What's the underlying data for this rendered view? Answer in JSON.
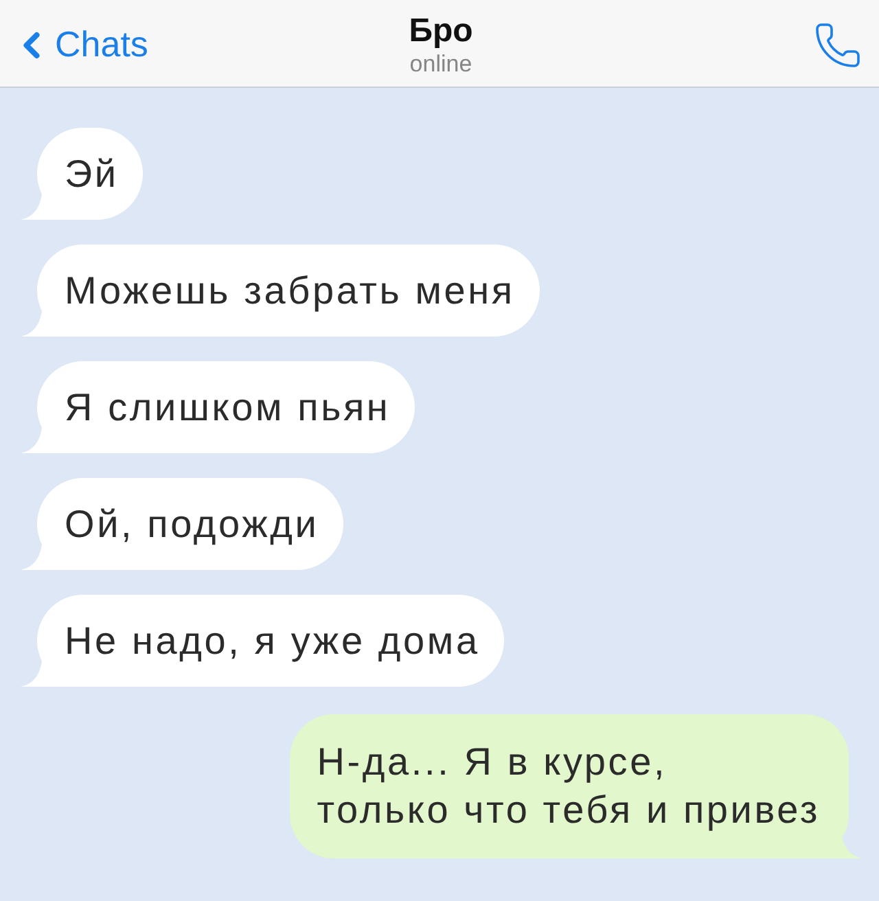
{
  "header": {
    "back": {
      "label": "Chats"
    },
    "title": "Бро",
    "status": "online"
  },
  "messages": [
    {
      "kind": "incoming",
      "text": "Эй"
    },
    {
      "kind": "incoming",
      "text": "Можешь забрать меня"
    },
    {
      "kind": "incoming",
      "text": "Я слишком пьян"
    },
    {
      "kind": "incoming",
      "text": "Ой, подожди"
    },
    {
      "kind": "incoming",
      "text": "Не надо, я уже дома"
    },
    {
      "kind": "outgoing",
      "text": "Н-да... Я в курсе,\nтолько что тебя и привез"
    }
  ]
}
